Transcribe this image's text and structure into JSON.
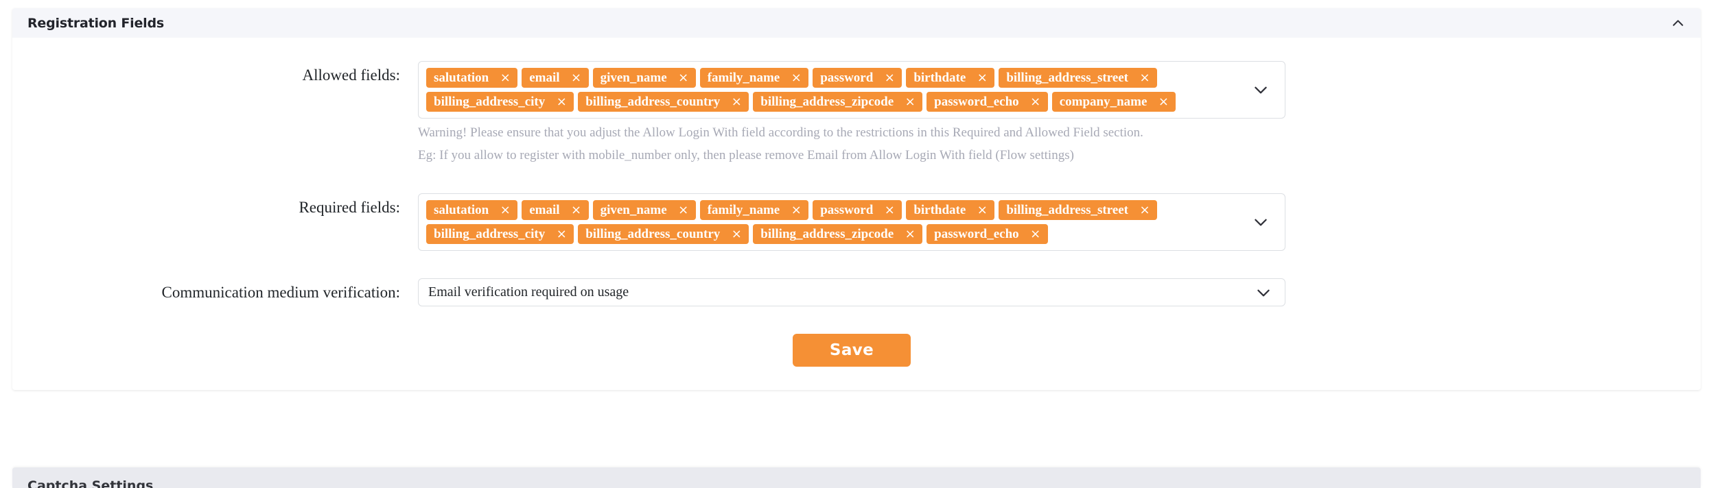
{
  "panel": {
    "title": "Registration Fields",
    "collapse_icon": "chevron-up-icon"
  },
  "allowed_fields": {
    "label": "Allowed fields:",
    "caret_icon": "chevron-down-icon",
    "tags": [
      "salutation",
      "email",
      "given_name",
      "family_name",
      "password",
      "birthdate",
      "billing_address_street",
      "billing_address_city",
      "billing_address_country",
      "billing_address_zipcode",
      "password_echo",
      "company_name"
    ],
    "help": [
      "Warning! Please ensure that you adjust the Allow Login With field according to the restrictions in this Required and Allowed Field section.",
      "Eg: If you allow to register with mobile_number only, then please remove Email from Allow Login With field (Flow settings)"
    ]
  },
  "required_fields": {
    "label": "Required fields:",
    "caret_icon": "chevron-down-icon",
    "tags": [
      "salutation",
      "email",
      "given_name",
      "family_name",
      "password",
      "birthdate",
      "billing_address_street",
      "billing_address_city",
      "billing_address_country",
      "billing_address_zipcode",
      "password_echo"
    ]
  },
  "communication_medium_verification": {
    "label": "Communication medium verification:",
    "value": "Email verification required on usage",
    "caret_icon": "chevron-down-icon"
  },
  "actions": {
    "save_label": "Save"
  },
  "next_panel": {
    "title": "Captcha Settings"
  },
  "colors": {
    "tag_orange": "#f59035",
    "header_bg": "#f5f6fa",
    "help_text": "#a7a9b5",
    "border": "#dcdfe3"
  },
  "tag_remove_glyph": "×"
}
